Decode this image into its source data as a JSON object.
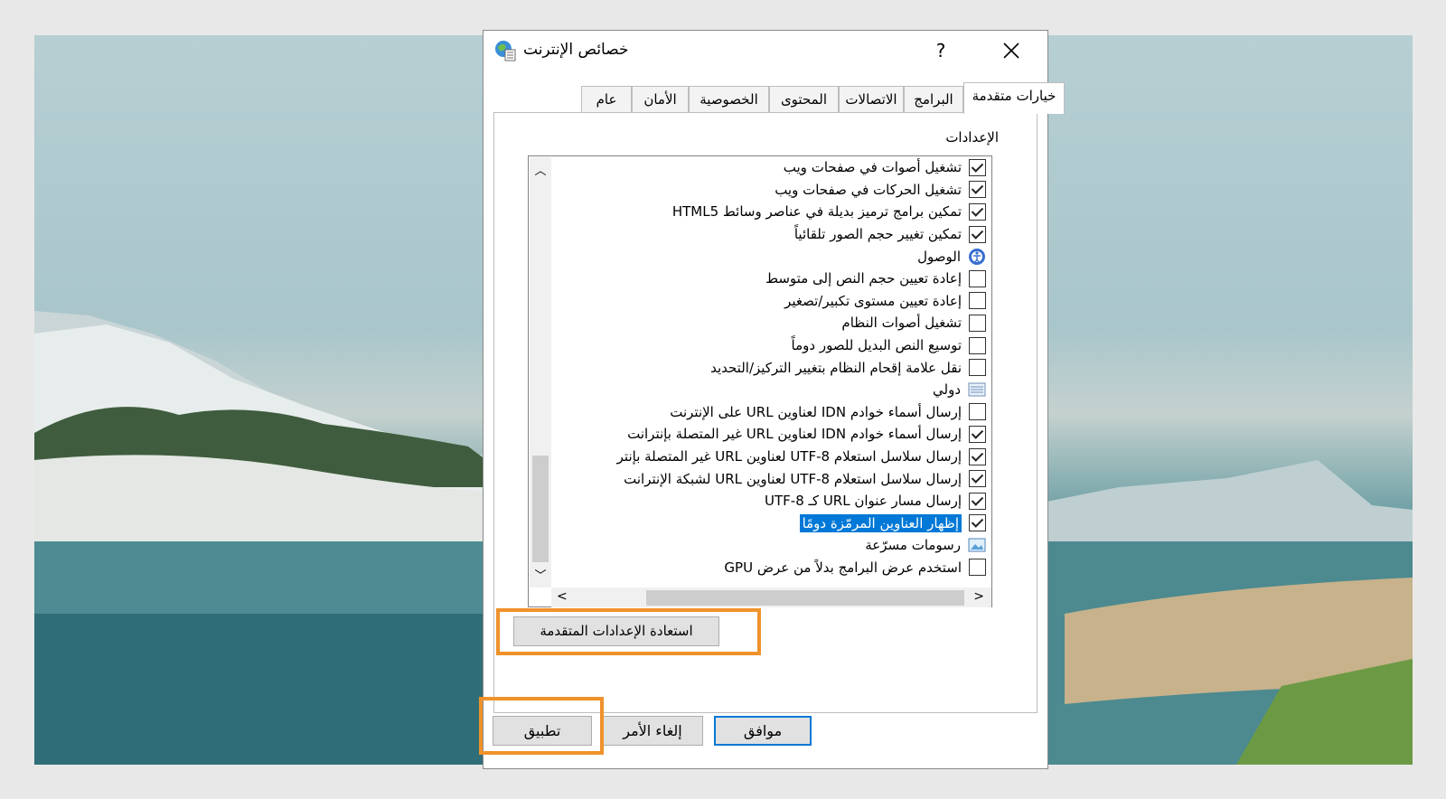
{
  "dialog": {
    "title": "خصائص الإنترنت",
    "help_label": "?"
  },
  "tabs": [
    "خيارات متقدمة",
    "البرامج",
    "الاتصالات",
    "المحتوى",
    "الخصوصية",
    "الأمان",
    "عام"
  ],
  "settings_group_label": "الإعدادات",
  "settings_items": [
    {
      "kind": "check",
      "checked": true,
      "label": "تشغيل أصوات في صفحات ويب"
    },
    {
      "kind": "check",
      "checked": true,
      "label": "تشغيل الحركات في صفحات ويب"
    },
    {
      "kind": "check",
      "checked": true,
      "label": "تمكين برامج ترميز بديلة في عناصر وسائط HTML5"
    },
    {
      "kind": "check",
      "checked": true,
      "label": "تمكين تغيير حجم الصور تلقائياً"
    },
    {
      "kind": "category",
      "icon": "accessibility-icon",
      "label": "الوصول"
    },
    {
      "kind": "check",
      "checked": false,
      "label": "إعادة تعيين حجم النص إلى متوسط"
    },
    {
      "kind": "check",
      "checked": false,
      "label": "إعادة تعيين مستوى تكبير/تصغير"
    },
    {
      "kind": "check",
      "checked": false,
      "label": "تشغيل أصوات النظام"
    },
    {
      "kind": "check",
      "checked": false,
      "label": "توسيع النص البديل للصور دوماً"
    },
    {
      "kind": "check",
      "checked": false,
      "label": "نقل علامة إقحام النظام بتغيير التركيز/التحديد"
    },
    {
      "kind": "category",
      "icon": "international-icon",
      "label": "دولي"
    },
    {
      "kind": "check",
      "checked": false,
      "label": "إرسال أسماء خوادم IDN لعناوين URL على الإنترنت"
    },
    {
      "kind": "check",
      "checked": true,
      "label": "إرسال أسماء خوادم IDN لعناوين URL غير المتصلة بإنترانت"
    },
    {
      "kind": "check",
      "checked": true,
      "label": "إرسال سلاسل استعلام UTF-8 لعناوين URL غير المتصلة بإنتر"
    },
    {
      "kind": "check",
      "checked": true,
      "label": "إرسال سلاسل استعلام UTF-8 لعناوين URL لشبكة الإنترانت"
    },
    {
      "kind": "check",
      "checked": true,
      "label": "إرسال مسار عنوان URL كـ UTF-8"
    },
    {
      "kind": "check",
      "checked": true,
      "label": "إظهار العناوين المرمّزة دومًا",
      "selected": true
    },
    {
      "kind": "category",
      "icon": "graphics-icon",
      "label": "رسومات مسرّعة"
    },
    {
      "kind": "check",
      "checked": false,
      "label": "استخدم عرض البرامج بدلاً من عرض GPU"
    }
  ],
  "restore_button": "استعادة الإعدادات المتقدمة",
  "buttons": {
    "ok": "موافق",
    "cancel": "إلغاء الأمر",
    "apply": "تطبيق"
  },
  "colors": {
    "highlight_box": "#f0922b",
    "selection": "#0078d7"
  }
}
